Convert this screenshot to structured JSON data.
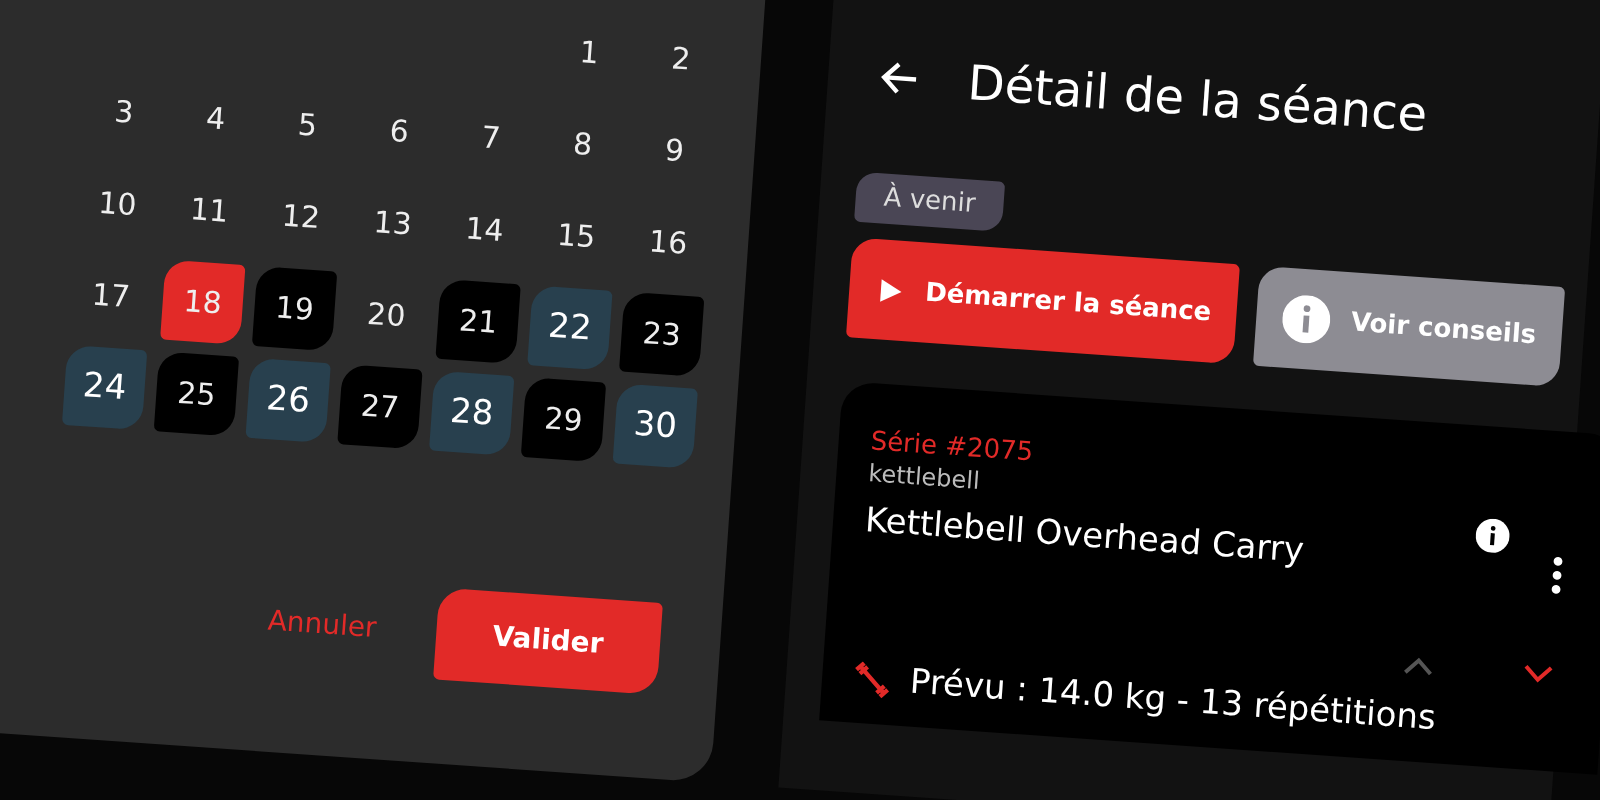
{
  "calendar": {
    "days": [
      {
        "label": "1",
        "kind": "plain",
        "selected": false
      },
      {
        "label": "2",
        "kind": "plain",
        "selected": false
      },
      {
        "label": "3",
        "kind": "plain",
        "selected": false
      },
      {
        "label": "4",
        "kind": "plain",
        "selected": false
      },
      {
        "label": "5",
        "kind": "plain",
        "selected": false
      },
      {
        "label": "6",
        "kind": "plain",
        "selected": false
      },
      {
        "label": "7",
        "kind": "plain",
        "selected": false
      },
      {
        "label": "8",
        "kind": "plain",
        "selected": false
      },
      {
        "label": "9",
        "kind": "plain",
        "selected": false
      },
      {
        "label": "10",
        "kind": "plain",
        "selected": false
      },
      {
        "label": "11",
        "kind": "plain",
        "selected": false
      },
      {
        "label": "12",
        "kind": "plain",
        "selected": false
      },
      {
        "label": "13",
        "kind": "plain",
        "selected": false
      },
      {
        "label": "14",
        "kind": "plain",
        "selected": false
      },
      {
        "label": "15",
        "kind": "plain",
        "selected": false
      },
      {
        "label": "16",
        "kind": "plain",
        "selected": false
      },
      {
        "label": "17",
        "kind": "plain",
        "selected": false
      },
      {
        "label": "18",
        "kind": "plain",
        "selected": true
      },
      {
        "label": "19",
        "kind": "done",
        "selected": false
      },
      {
        "label": "20",
        "kind": "plain",
        "selected": false
      },
      {
        "label": "21",
        "kind": "done",
        "selected": false
      },
      {
        "label": "22",
        "kind": "planned",
        "selected": false
      },
      {
        "label": "23",
        "kind": "done",
        "selected": false
      },
      {
        "label": "24",
        "kind": "planned",
        "selected": false
      },
      {
        "label": "25",
        "kind": "done",
        "selected": false
      },
      {
        "label": "26",
        "kind": "planned",
        "selected": false
      },
      {
        "label": "27",
        "kind": "done",
        "selected": false
      },
      {
        "label": "28",
        "kind": "planned",
        "selected": false
      },
      {
        "label": "29",
        "kind": "done",
        "selected": false
      },
      {
        "label": "30",
        "kind": "planned",
        "selected": false
      }
    ],
    "buttons": [
      "Annuler",
      "Valider"
    ]
  },
  "detail": {
    "title": "Détail de la séance",
    "status": "À venir",
    "actions": [
      {
        "label": "Démarrer la séance",
        "kind": "primary"
      },
      {
        "label": "Voir conseils",
        "kind": "secondary"
      }
    ],
    "exercise": {
      "series": "Série #2075",
      "equipment": "kettlebell",
      "name": "Kettlebell Overhead Carry",
      "move_up_disabled": true,
      "planned": "Prévu : 14.0 kg - 13 répétitions"
    }
  }
}
